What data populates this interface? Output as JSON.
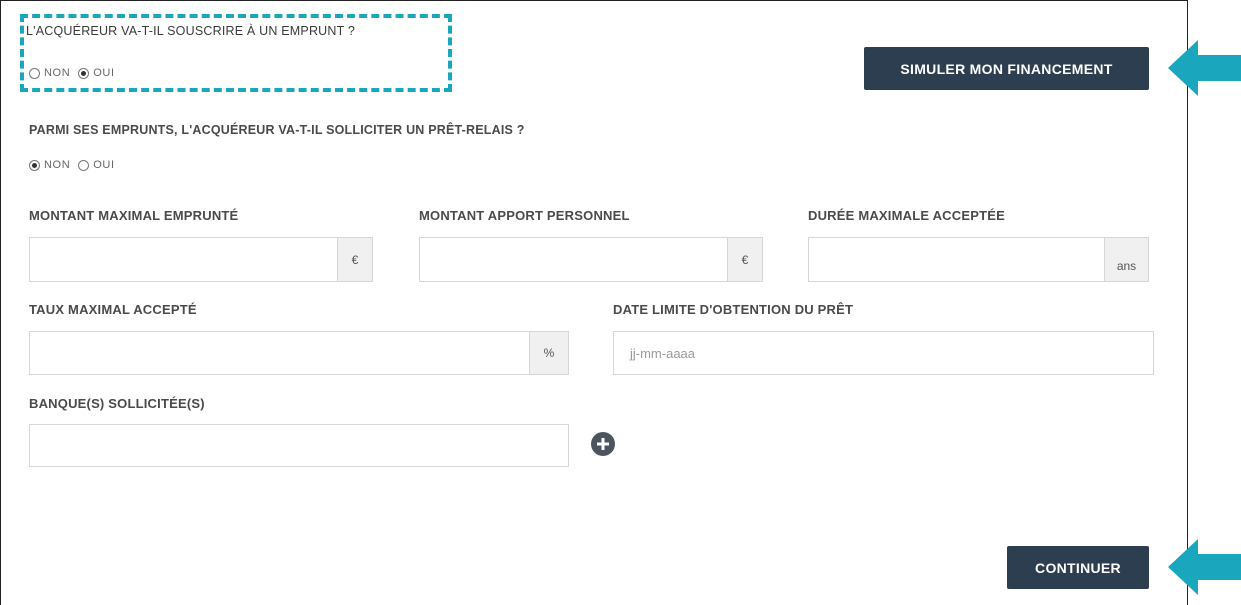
{
  "loan_question": {
    "label": "L'ACQUÉREUR VA-T-IL SOUSCRIRE À UN EMPRUNT ?",
    "options": [
      {
        "label": "NON",
        "checked": false
      },
      {
        "label": "OUI",
        "checked": true
      }
    ]
  },
  "simulate_button": {
    "label": "SIMULER MON FINANCEMENT"
  },
  "bridge_loan_question": {
    "label": "PARMI SES EMPRUNTS, L'ACQUÉREUR VA-T-IL SOLLICITER UN PRÊT-RELAIS ?",
    "options": [
      {
        "label": "NON",
        "checked": true
      },
      {
        "label": "OUI",
        "checked": false
      }
    ]
  },
  "fields": {
    "max_amount": {
      "label": "MONTANT MAXIMAL EMPRUNTÉ",
      "unit": "€",
      "value": ""
    },
    "personal_contribution": {
      "label": "MONTANT APPORT PERSONNEL",
      "unit": "€",
      "value": ""
    },
    "max_duration": {
      "label": "DURÉE MAXIMALE ACCEPTÉE",
      "unit": "ans",
      "value": ""
    },
    "max_rate": {
      "label": "TAUX MAXIMAL ACCEPTÉ",
      "unit": "%",
      "value": ""
    },
    "deadline": {
      "label": "DATE LIMITE D'OBTENTION DU PRÊT",
      "placeholder": "jj-mm-aaaa",
      "value": ""
    },
    "banks": {
      "label": "BANQUE(S) SOLLICITÉE(S)",
      "value": ""
    }
  },
  "continue_button": {
    "label": "CONTINUER"
  },
  "colors": {
    "accent": "#1aa7bd",
    "button": "#2d3e50"
  },
  "icons": {
    "add": "plus-circle-icon",
    "arrow": "arrow-left-icon"
  }
}
